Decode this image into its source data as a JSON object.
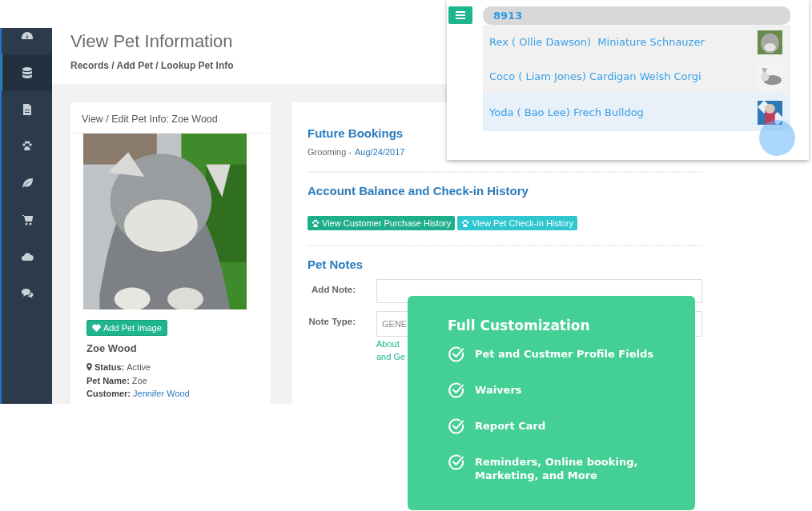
{
  "sidebar": {
    "items": [
      {
        "selected": false
      },
      {
        "selected": true
      },
      {
        "selected": false
      },
      {
        "selected": false
      },
      {
        "selected": false
      },
      {
        "selected": false
      },
      {
        "selected": false
      },
      {
        "selected": false
      }
    ]
  },
  "page": {
    "title": "View Pet Information",
    "breadcrumb": "Records / Add Pet / Lookup Pet Info"
  },
  "pet_card": {
    "title": "View / Edit Pet Info: Zoe Wood",
    "add_image_button": "Add Pet Image",
    "name": "Zoe Wood",
    "fields": [
      {
        "label": "Status:",
        "value": "Active",
        "kind": "status"
      },
      {
        "label": "Pet Name:",
        "value": "Zoe",
        "kind": "text"
      },
      {
        "label": "Customer:",
        "value": "Jennifer Wood",
        "kind": "link"
      }
    ]
  },
  "future_bookings": {
    "heading": "Future Bookings",
    "service": "Grooming -",
    "date": "Aug/24/2017"
  },
  "account": {
    "heading": "Account Balance and Check-in History",
    "buttons": [
      {
        "label": "View Customer Purchase History",
        "color": "#1fae8c"
      },
      {
        "label": "View Pet Check-in History",
        "color": "#2ec6cf"
      }
    ]
  },
  "pet_notes": {
    "heading": "Pet Notes",
    "add_note_label": "Add Note:",
    "note_type_label": "Note Type:",
    "note_type_value": "GENE",
    "hint_lines": [
      "About",
      "and Ge"
    ]
  },
  "search": {
    "value": "8913",
    "results": [
      {
        "text": "Rex ( Ollie Dawson)  Miniature Schnauzer",
        "selected": false
      },
      {
        "text": "Coco ( Liam Jones) Cardigan Welsh Corgi",
        "selected": false
      },
      {
        "text": "Yoda ( Bao Lee) Frech Bulldog",
        "selected": true
      }
    ]
  },
  "promo": {
    "title": "Full Customization",
    "items": [
      "Pet and Custmer Profile Fields",
      "Waivers",
      "Report Card",
      "Reminders, Online booking, Marketing, and More"
    ]
  }
}
